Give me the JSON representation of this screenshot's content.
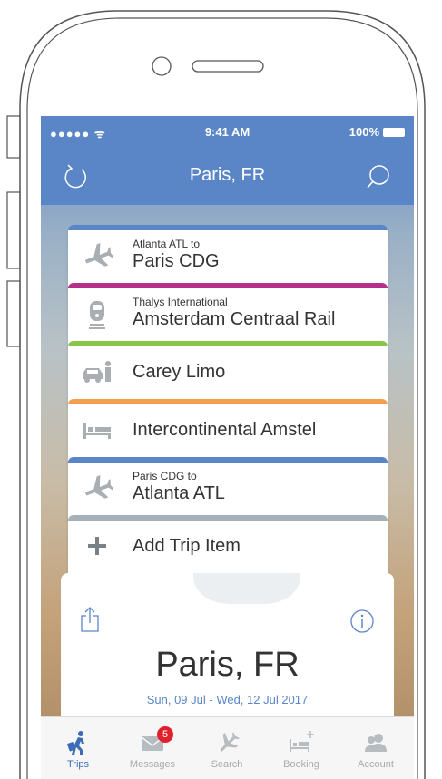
{
  "status_bar": {
    "carrier": "●●●●● ᯤ",
    "time": "9:41 AM",
    "battery": "100%"
  },
  "nav": {
    "title": "Paris, FR"
  },
  "trip_items": [
    {
      "sub": "Atlanta ATL to",
      "main": "Paris CDG",
      "color": "#5a86c8",
      "icon": "plane-icon"
    },
    {
      "sub": "Thalys International",
      "main": "Amsterdam Centraal Rail",
      "color": "#b5308a",
      "icon": "train-icon"
    },
    {
      "sub": "",
      "main": "Carey Limo",
      "color": "#86c548",
      "icon": "car-icon"
    },
    {
      "sub": "",
      "main": "Intercontinental Amstel",
      "color": "#f0a04e",
      "icon": "bed-icon"
    },
    {
      "sub": "Paris CDG to",
      "main": "Atlanta ATL",
      "color": "#5a86c8",
      "icon": "plane-icon"
    },
    {
      "sub": "",
      "main": "Add Trip Item",
      "color": "#a6b0b8",
      "icon": "plus-icon"
    }
  ],
  "detail": {
    "title": "Paris, FR",
    "dates": "Sun, 09 Jul - Wed, 12 Jul 2017"
  },
  "tabs": [
    {
      "label": "Trips",
      "icon": "traveler-icon",
      "active": true
    },
    {
      "label": "Messages",
      "icon": "message-icon",
      "badge": "5"
    },
    {
      "label": "Search",
      "icon": "plane-icon"
    },
    {
      "label": "Booking",
      "icon": "bed-plus-icon"
    },
    {
      "label": "Account",
      "icon": "account-icon"
    }
  ]
}
